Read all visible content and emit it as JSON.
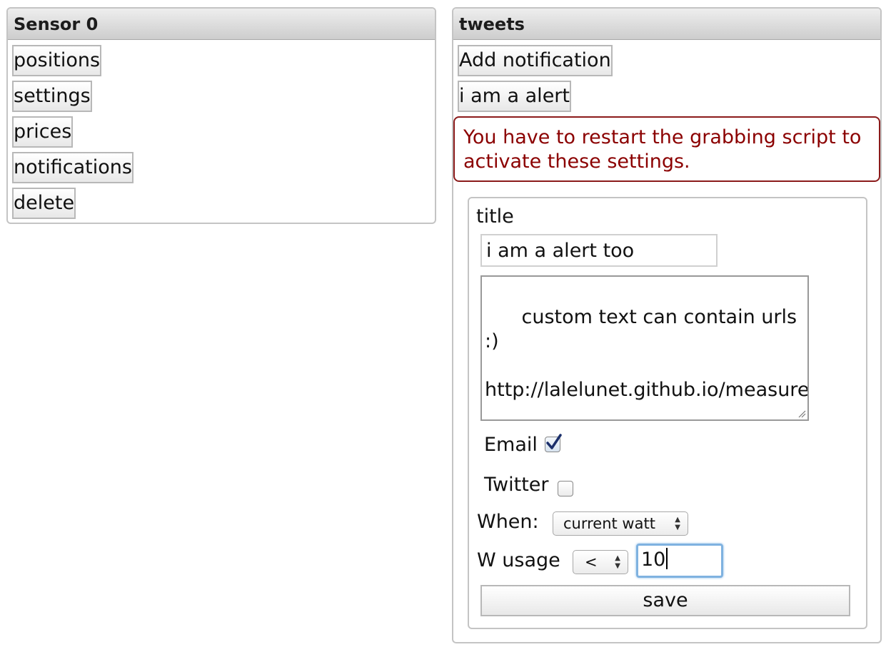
{
  "left_panel": {
    "title": "Sensor 0",
    "buttons": [
      "positions",
      "settings",
      "prices",
      "notifications",
      "delete"
    ]
  },
  "right_panel": {
    "title": "tweets",
    "add_button": "Add notification",
    "existing_alert": "i am a alert",
    "warning": "You have to restart the grabbing script to activate these settings.",
    "form": {
      "title_label": "title",
      "title_value": "i am a alert too",
      "body_text": "custom text can contain urls :)\n\nhttp://lalelunet.github.io/measureit/",
      "email_label": "Email",
      "email_checked": true,
      "twitter_label": "Twitter",
      "twitter_checked": false,
      "when_label": "When:",
      "when_value": "current watt",
      "usage_label": "W usage",
      "operator_value": "<",
      "threshold_value": "10",
      "save_label": "save"
    }
  },
  "colors": {
    "warning_text": "#8b0000",
    "warning_border": "#8b1a1a",
    "focus_ring": "#7fb2e0",
    "checkmark": "#1b2f6b"
  },
  "icons": {
    "email_checkbox": "checkmark-icon",
    "select_arrows": "updown-arrows-icon",
    "resize": "resize-grip-icon"
  }
}
